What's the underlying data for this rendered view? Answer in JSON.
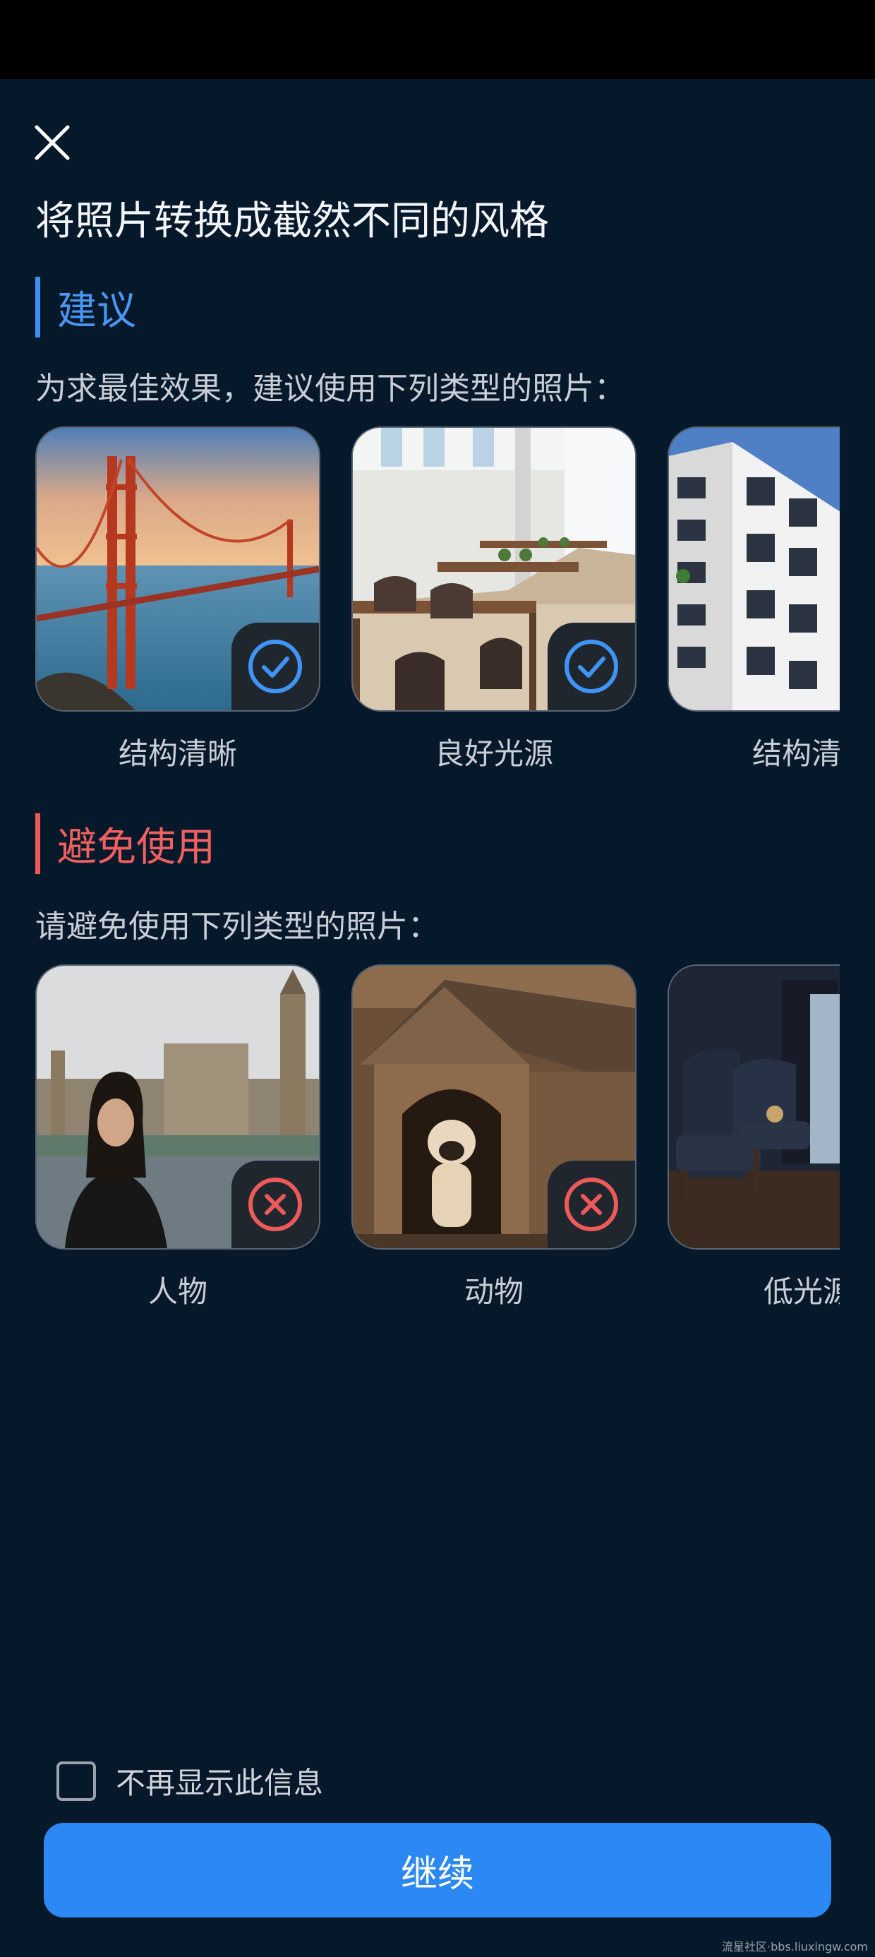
{
  "header": {
    "close_icon": "close-icon",
    "title": "将照片转换成截然不同的风格"
  },
  "suggest": {
    "heading": "建议",
    "description": "为求最佳效果，建议使用下列类型的照片：",
    "accent": "#3f8ef5",
    "badge_icon": "check-circle-icon",
    "cards": [
      {
        "label": "结构清晰"
      },
      {
        "label": "良好光源"
      },
      {
        "label": "结构清"
      }
    ]
  },
  "avoid": {
    "heading": "避免使用",
    "description": "请避免使用下列类型的照片：",
    "accent": "#ec5a5a",
    "badge_icon": "x-circle-icon",
    "cards": [
      {
        "label": "人物"
      },
      {
        "label": "动物"
      },
      {
        "label": "低光源"
      }
    ]
  },
  "footer": {
    "checkbox_label": "不再显示此信息",
    "checkbox_checked": false,
    "continue_label": "继续",
    "button_color": "#2b88f4"
  },
  "watermark": "流星社区·bbs.liuxingw.com"
}
